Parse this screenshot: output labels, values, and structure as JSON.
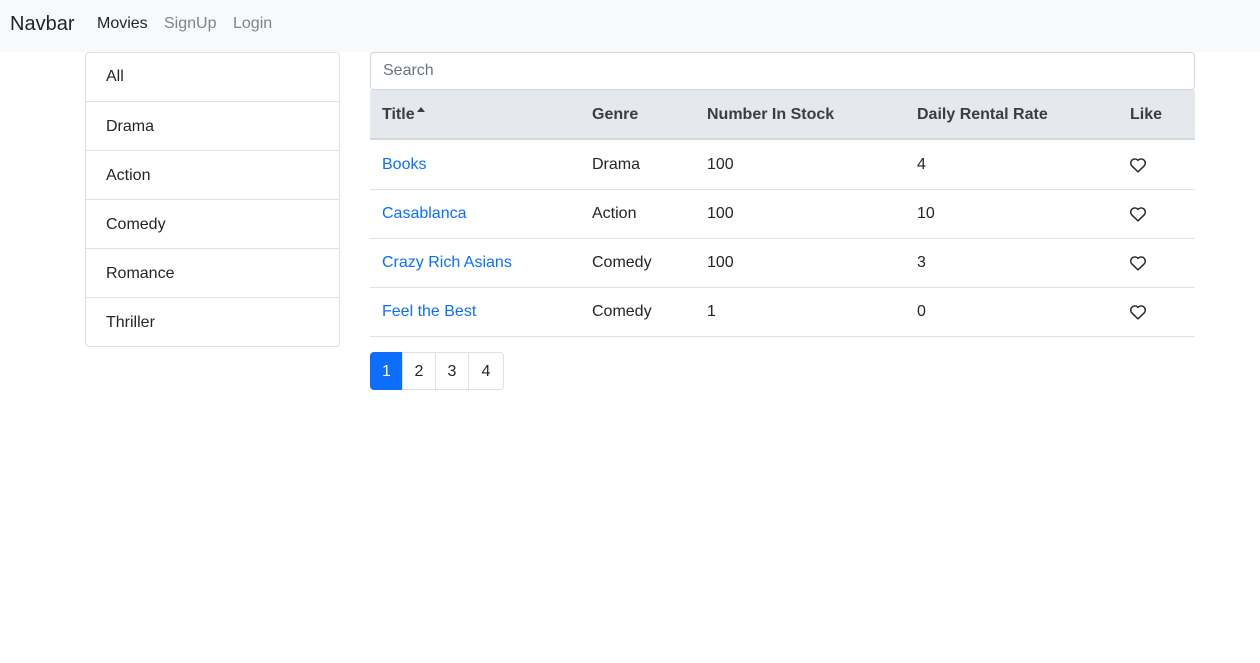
{
  "navbar": {
    "brand": "Navbar",
    "links": [
      {
        "label": "Movies",
        "active": true
      },
      {
        "label": "SignUp",
        "active": false
      },
      {
        "label": "Login",
        "active": false
      }
    ]
  },
  "genres": [
    "All",
    "Drama",
    "Action",
    "Comedy",
    "Romance",
    "Thriller"
  ],
  "search": {
    "placeholder": "Search",
    "value": ""
  },
  "table": {
    "headers": [
      "Title",
      "Genre",
      "Number In Stock",
      "Daily Rental Rate",
      "Like"
    ],
    "sorted_column": "Title",
    "sort_direction": "ascending",
    "rows": [
      {
        "title": "Books",
        "genre": "Drama",
        "stock": "100",
        "rate": "4",
        "liked": false
      },
      {
        "title": "Casablanca",
        "genre": "Action",
        "stock": "100",
        "rate": "10",
        "liked": false
      },
      {
        "title": "Crazy Rich Asians",
        "genre": "Comedy",
        "stock": "100",
        "rate": "3",
        "liked": false
      },
      {
        "title": "Feel the Best",
        "genre": "Comedy",
        "stock": "1",
        "rate": "0",
        "liked": false
      }
    ]
  },
  "pagination": {
    "pages": [
      "1",
      "2",
      "3",
      "4"
    ],
    "current": "1"
  },
  "colors": {
    "accent": "#0d6efd",
    "navbar_bg": "#f8f9fa",
    "table_header_bg": "#e5e8ec"
  }
}
